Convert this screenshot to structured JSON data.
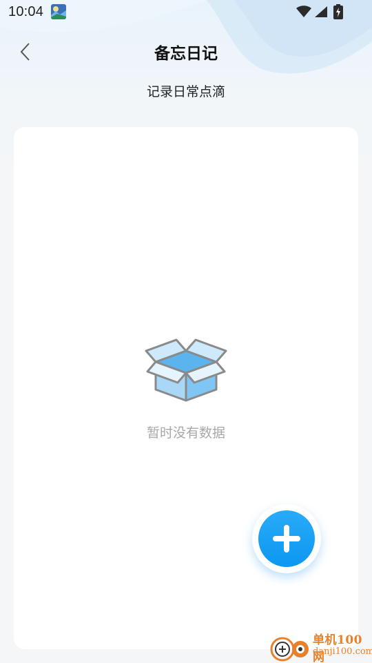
{
  "status_bar": {
    "time": "10:04",
    "icons": [
      "notification-image-icon",
      "wifi-icon",
      "signal-icon",
      "battery-charging-icon"
    ]
  },
  "header": {
    "back_icon": "chevron-left-icon",
    "title": "备忘日记",
    "subtitle": "记录日常点滴"
  },
  "content": {
    "empty_icon": "empty-box-icon",
    "empty_text": "暂时没有数据"
  },
  "fab": {
    "icon": "plus-icon",
    "color": "#109cf3"
  },
  "watermark": {
    "brand": "单机100网",
    "url": "danji100.com"
  },
  "colors": {
    "accent": "#109cf3",
    "title_text": "#111111",
    "muted_text": "#a8a8a8",
    "card_bg": "#ffffff",
    "page_bg": "#f4f6f8"
  }
}
